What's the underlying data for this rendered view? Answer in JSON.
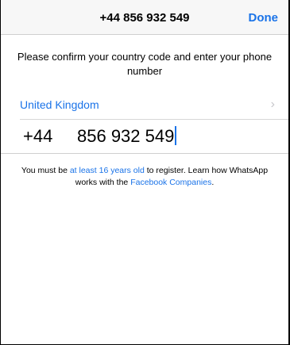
{
  "navbar": {
    "title": "+44 856 932 549",
    "done_label": "Done"
  },
  "instruction": "Please confirm your country code and enter your phone number",
  "country": {
    "name": "United Kingdom",
    "chevron": "›"
  },
  "phone": {
    "code": "+44",
    "number": "856 932 549"
  },
  "terms": {
    "part1": "You must be ",
    "age_link": "at least 16 years old",
    "part2": " to register. Learn how WhatsApp works with the ",
    "companies_link": "Facebook Companies",
    "part3": "."
  },
  "colors": {
    "accent": "#1a73e8",
    "navbar_bg": "#f7f7f7",
    "chevron": "#c7c7cc"
  },
  "icons": {
    "chevron": "chevron-right-icon"
  }
}
